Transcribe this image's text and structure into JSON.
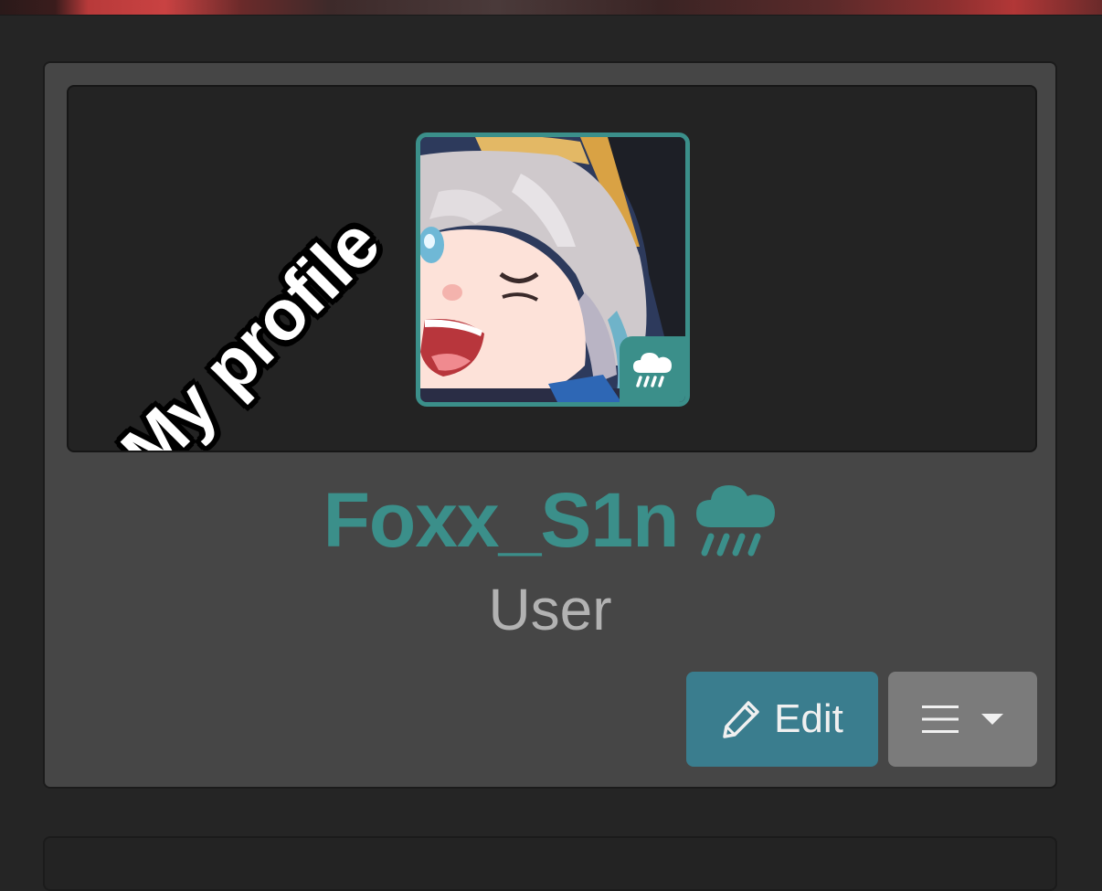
{
  "profile": {
    "banner_sticker_text": "My profile",
    "username": "Foxx_S1n",
    "role": "User",
    "status_icon": "cloud-rain-icon",
    "accent_color": "#3b8f8a"
  },
  "actions": {
    "edit_label": "Edit",
    "edit_icon": "pencil-icon",
    "menu_icon": "hamburger-icon",
    "menu_caret_icon": "caret-down-icon"
  }
}
